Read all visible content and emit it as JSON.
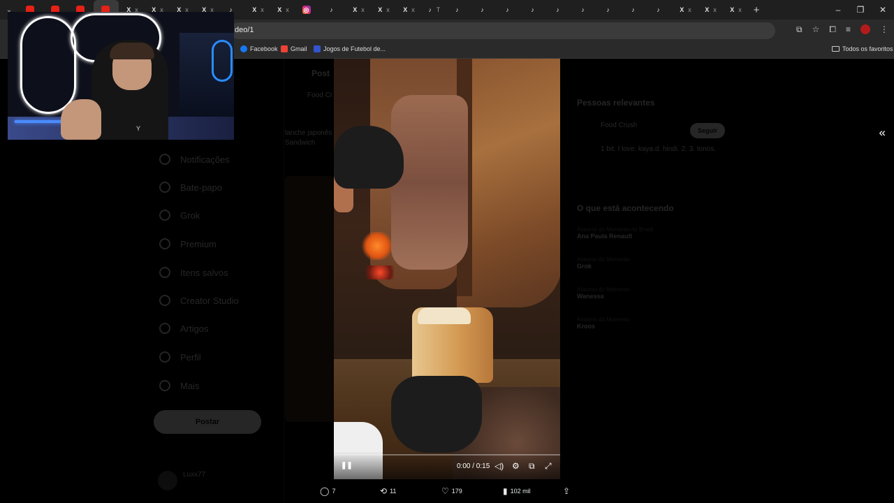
{
  "browser": {
    "tabs": [
      {
        "icon": "youtube-icon",
        "fav": "",
        "label": "",
        "type": "yt"
      },
      {
        "icon": "youtube-icon",
        "fav": "",
        "label": "",
        "type": "yt"
      },
      {
        "icon": "youtube-icon",
        "fav": "",
        "label": "",
        "type": "yt"
      },
      {
        "icon": "youtube-icon",
        "fav": "",
        "label": "",
        "type": "yt"
      },
      {
        "icon": "x-icon",
        "fav": "X",
        "label": "x",
        "type": "x"
      },
      {
        "icon": "x-icon",
        "fav": "X",
        "label": "x",
        "type": "x"
      },
      {
        "icon": "x-icon",
        "fav": "X",
        "label": "x",
        "type": "x"
      },
      {
        "icon": "x-icon",
        "fav": "X",
        "label": "x",
        "type": "x"
      },
      {
        "icon": "tiktok-icon",
        "fav": "♪",
        "label": "",
        "type": "tt"
      },
      {
        "icon": "x-icon",
        "fav": "X",
        "label": "x",
        "type": "x"
      },
      {
        "icon": "x-icon",
        "fav": "X",
        "label": "x",
        "type": "x"
      },
      {
        "icon": "instagram-icon",
        "fav": "◎",
        "label": "",
        "type": "ig"
      },
      {
        "icon": "tiktok-icon",
        "fav": "♪",
        "label": "",
        "type": "tt"
      },
      {
        "icon": "x-icon",
        "fav": "X",
        "label": "x",
        "type": "x"
      },
      {
        "icon": "x-icon",
        "fav": "X",
        "label": "x",
        "type": "x"
      },
      {
        "icon": "x-icon",
        "fav": "X",
        "label": "x",
        "type": "x"
      },
      {
        "icon": "tiktok-icon",
        "fav": "♪",
        "label": "T",
        "type": "tt"
      },
      {
        "icon": "tiktok-icon",
        "fav": "♪",
        "label": "",
        "type": "tt"
      },
      {
        "icon": "tiktok-icon",
        "fav": "♪",
        "label": "",
        "type": "tt"
      },
      {
        "icon": "tiktok-icon",
        "fav": "♪",
        "label": "",
        "type": "tt"
      },
      {
        "icon": "tiktok-icon",
        "fav": "♪",
        "label": "",
        "type": "tt"
      },
      {
        "icon": "tiktok-icon",
        "fav": "♪",
        "label": "",
        "type": "tt"
      },
      {
        "icon": "tiktok-icon",
        "fav": "♪",
        "label": "",
        "type": "tt"
      },
      {
        "icon": "tiktok-icon",
        "fav": "♪",
        "label": "",
        "type": "tt"
      },
      {
        "icon": "tiktok-icon",
        "fav": "♪",
        "label": "",
        "type": "tt"
      },
      {
        "icon": "tiktok-icon",
        "fav": "♪",
        "label": "",
        "type": "tt"
      },
      {
        "icon": "x-icon",
        "fav": "X",
        "label": "x",
        "type": "x"
      },
      {
        "icon": "x-icon",
        "fav": "X",
        "label": "x",
        "type": "x"
      },
      {
        "icon": "x-icon",
        "fav": "X",
        "label": "x",
        "type": "x"
      }
    ],
    "new_tab": "+",
    "window": {
      "minimize": "–",
      "restore": "❐",
      "close": "✕"
    },
    "url": "deo/1",
    "bookmarks": [
      "Facebook",
      "Gmail",
      "Jogos de Futebol de..."
    ],
    "all_bookmarks": "Todos os favoritos"
  },
  "x_page": {
    "nav": [
      "Notificações",
      "Bate-papo",
      "Grok",
      "Premium",
      "Itens salvos",
      "Creator Studio",
      "Artigos",
      "Perfil",
      "Mais"
    ],
    "post_button": "Postar",
    "account_name": "Luxx77",
    "header": "Post",
    "post_author": "Food Cr",
    "post_text": "lanche japonês Sandwich",
    "relevant_title": "Pessoas relevantes",
    "relevant_account": "Food Crush",
    "relevant_bio": "1 bit. I love. kaya.d. hindi. 2. 3. tonos.",
    "follow_button": "Seguir",
    "trending_title": "O que está acontecendo",
    "trends": [
      {
        "meta": "Assunto do Momento no Brasil",
        "name": "Ana Paula Renault"
      },
      {
        "meta": "Assunto do Momento",
        "name": "Grok"
      },
      {
        "meta": "Assunto do Momento",
        "name": "Wanessa"
      },
      {
        "meta": "Assunto do Momento",
        "name": "Kroos"
      }
    ]
  },
  "video": {
    "time": "0:00 / 0:15",
    "progress": 0.0
  },
  "actions": {
    "replies": "7",
    "reposts": "11",
    "likes": "179",
    "views": "102 mil"
  },
  "colors": {
    "accent": "#1d9bf0",
    "youtube": "#e62117",
    "facebook": "#1877f2",
    "gmail": "#ea4335"
  }
}
